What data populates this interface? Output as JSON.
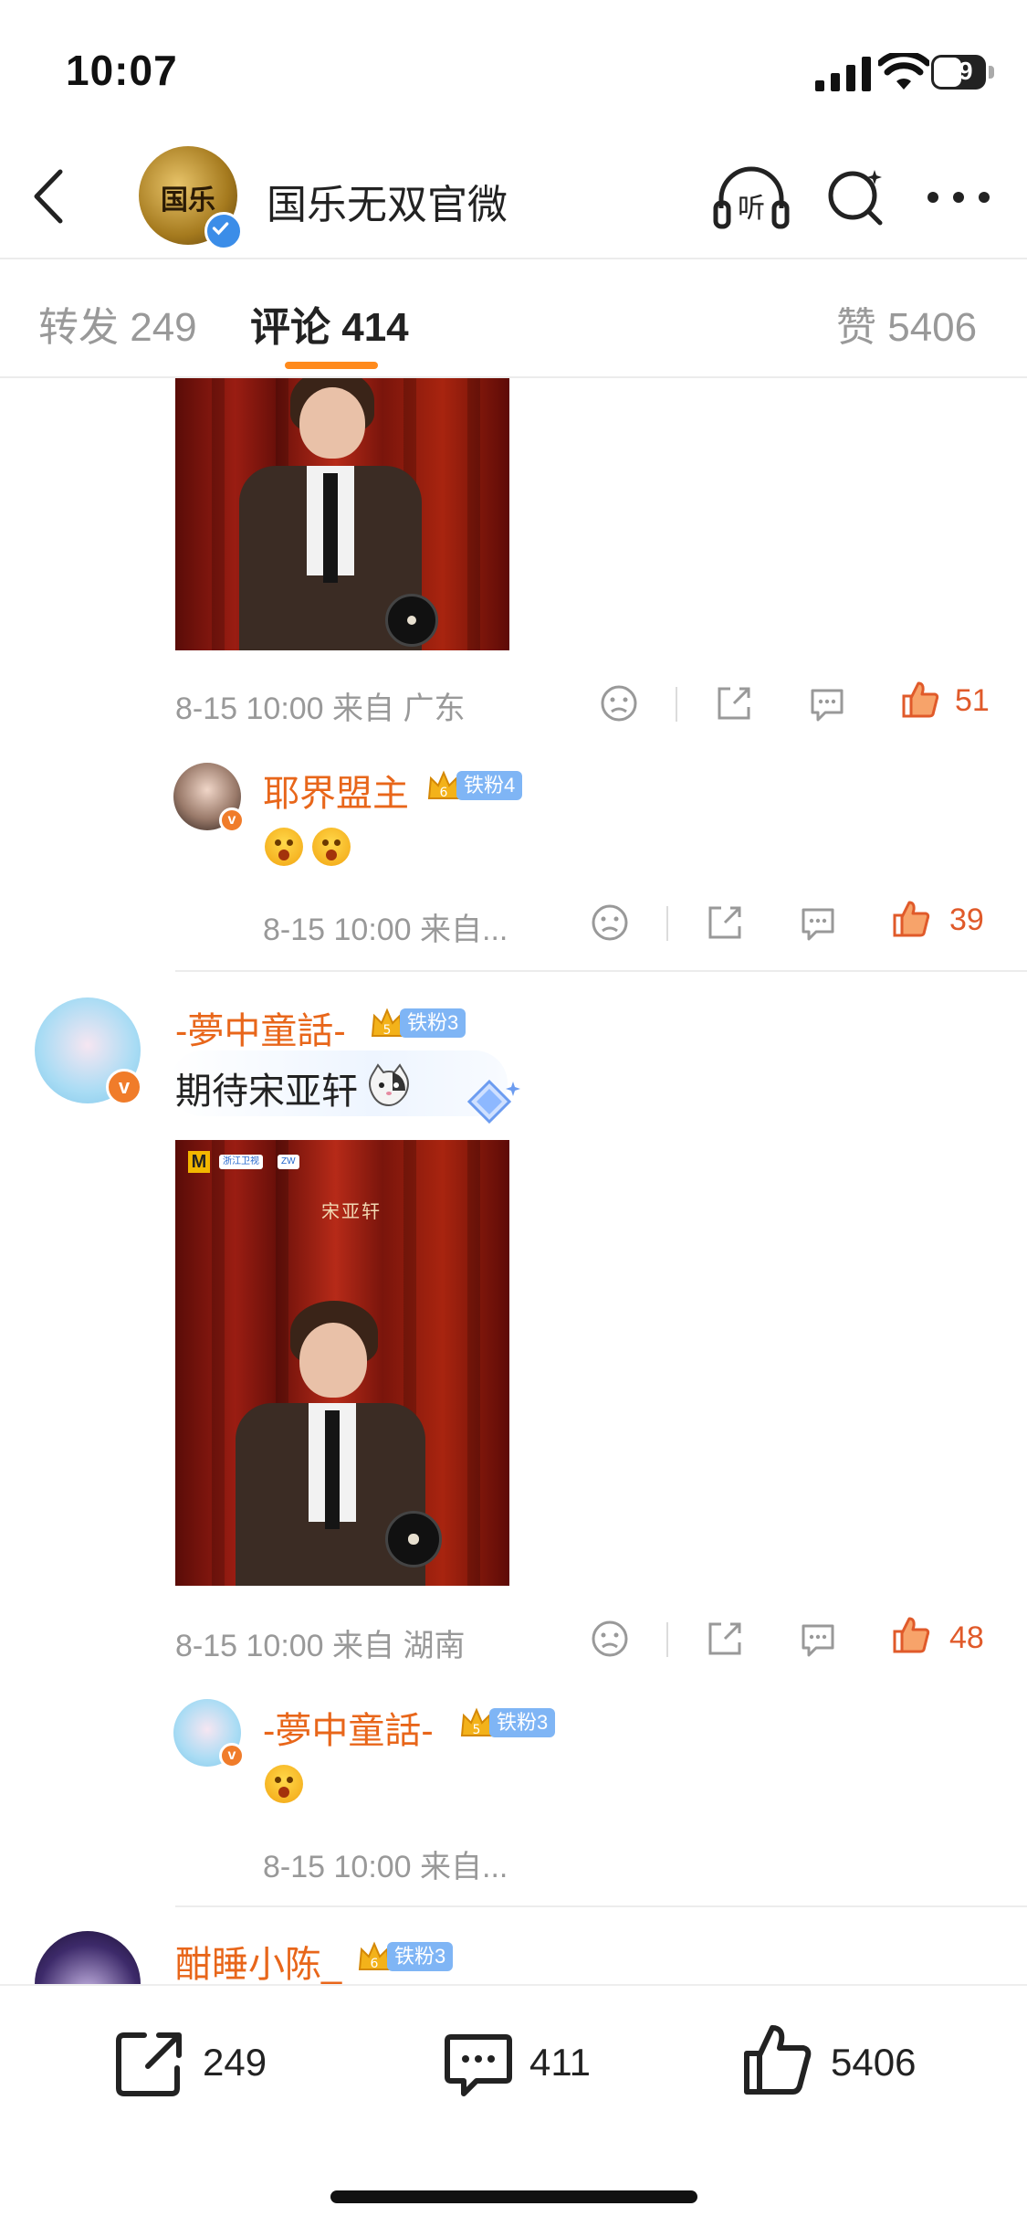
{
  "status_bar": {
    "time": "10:07",
    "battery": "59"
  },
  "header": {
    "title": "国乐无双官微",
    "avatar_text": "国乐"
  },
  "tabs": {
    "repost": {
      "label": "转发",
      "count": "249"
    },
    "comment": {
      "label": "评论",
      "count": "414"
    },
    "like": {
      "label": "赞",
      "count": "5406"
    }
  },
  "comments": [
    {
      "meta": "8-15 10:00 来自 广东",
      "likes": "51",
      "reply": {
        "name": "耶界盟主",
        "badge_label": "铁粉4",
        "badge_level": "6",
        "meta": "8-15 10:00 来自...",
        "likes": "39"
      }
    },
    {
      "name": "-夢中童話-",
      "badge_label": "铁粉3",
      "badge_level": "5",
      "text": "期待宋亚轩",
      "poster_title": "宋亚轩",
      "poster_chip1": "浙江卫视",
      "poster_chip2": "ZW",
      "meta": "8-15 10:00 来自 湖南",
      "likes": "48",
      "reply": {
        "name": "-夢中童話-",
        "badge_label": "铁粉3",
        "badge_level": "5",
        "meta": "8-15 10:00 来自..."
      }
    },
    {
      "name": "酣睡小陈_",
      "badge_label": "铁粉3",
      "badge_level": "6"
    }
  ],
  "bottom_bar": {
    "repost_count": "249",
    "comment_count": "411",
    "like_count": "5406"
  },
  "colors": {
    "accent_orange": "#e8661a",
    "like_red": "#e05a2a",
    "tab_underline": "#ff8a1c",
    "badge_blue": "#7fb5f5",
    "verified_blue": "#3b8de8"
  }
}
